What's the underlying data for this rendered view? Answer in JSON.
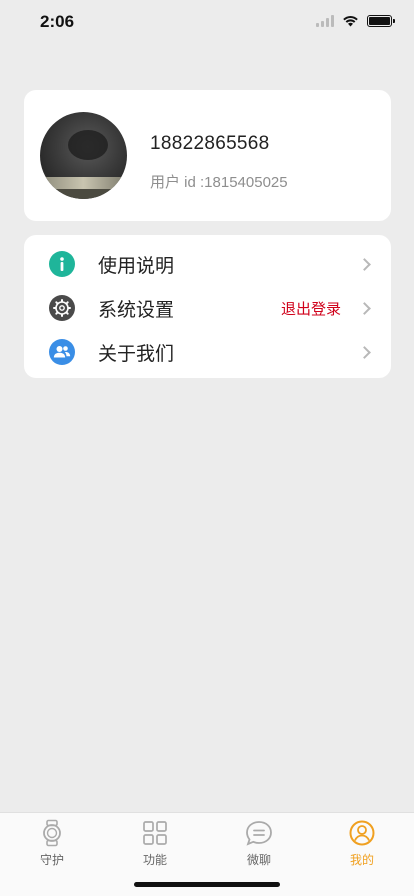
{
  "status_bar": {
    "time": "2:06"
  },
  "profile": {
    "phone": "18822865568",
    "user_id": "用户 id :1815405025"
  },
  "menu": {
    "items": [
      {
        "label": "使用说明",
        "icon": "info-icon",
        "color": "#1fb59a"
      },
      {
        "label": "系统设置",
        "icon": "gear-icon",
        "color": "#4a4a4a",
        "extra": "退出登录"
      },
      {
        "label": "关于我们",
        "icon": "users-icon",
        "color": "#3a8ee6"
      }
    ]
  },
  "tabs": [
    {
      "label": "守护",
      "icon": "watch-icon"
    },
    {
      "label": "功能",
      "icon": "grid-icon"
    },
    {
      "label": "微聊",
      "icon": "chat-icon"
    },
    {
      "label": "我的",
      "icon": "profile-icon",
      "active": true
    }
  ],
  "colors": {
    "accent": "#f0a020",
    "danger": "#d0021b"
  }
}
